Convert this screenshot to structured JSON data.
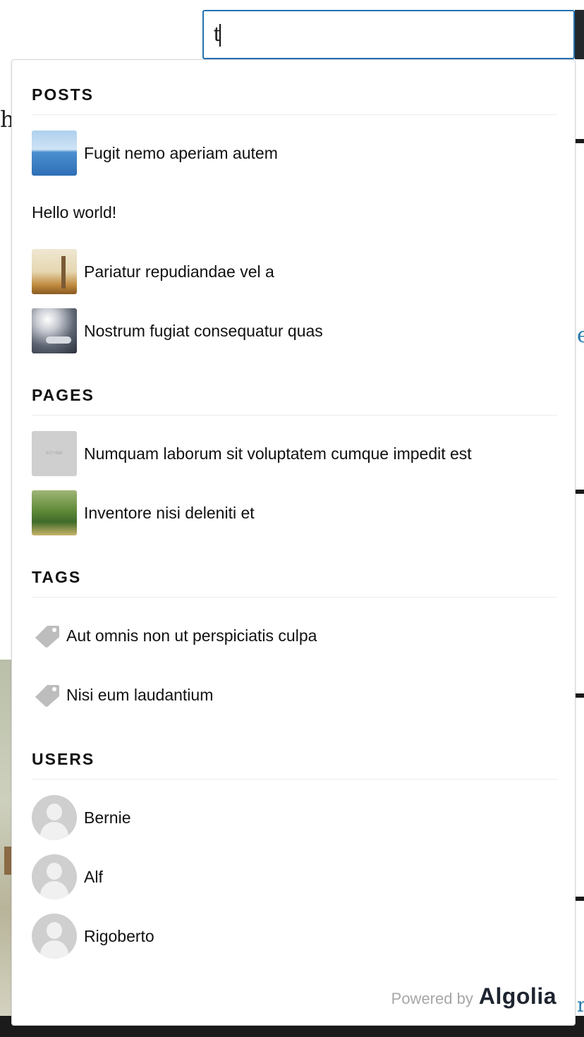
{
  "background": {
    "heading_fragment": "h",
    "link_fragment_1": "e",
    "link_fragment_2": "r"
  },
  "search": {
    "value": "t"
  },
  "dropdown": {
    "sections": {
      "posts": {
        "title": "POSTS",
        "items": [
          {
            "label": "Fugit nemo aperiam autem",
            "thumb": "sea-photo"
          },
          {
            "label": "Hello world!",
            "thumb": null
          },
          {
            "label": "Pariatur repudiandae vel a",
            "thumb": "fence-photo"
          },
          {
            "label": "Nostrum fugiat consequatur quas",
            "thumb": "phone-photo"
          }
        ]
      },
      "pages": {
        "title": "PAGES",
        "items": [
          {
            "label": "Numquam laborum sit voluptatem cumque impedit est",
            "thumb": "placeholder-image",
            "thumb_text": "637×589"
          },
          {
            "label": "Inventore nisi deleniti et",
            "thumb": "hillside-photo"
          }
        ]
      },
      "tags": {
        "title": "TAGS",
        "items": [
          {
            "label": "Aut omnis non ut perspiciatis culpa",
            "icon": "tag-icon"
          },
          {
            "label": "Nisi eum laudantium",
            "icon": "tag-icon"
          }
        ]
      },
      "users": {
        "title": "USERS",
        "items": [
          {
            "label": "Bernie",
            "icon": "avatar-placeholder"
          },
          {
            "label": "Alf",
            "icon": "avatar-placeholder"
          },
          {
            "label": "Rigoberto",
            "icon": "avatar-placeholder"
          }
        ]
      }
    },
    "footer": {
      "powered_by": "Powered by",
      "brand": "Algolia"
    }
  },
  "colors": {
    "input_border": "#2271b1",
    "tag_icon": "#bdbdbd",
    "section_divider": "#ececec",
    "link_blue": "#2a7ab0"
  }
}
